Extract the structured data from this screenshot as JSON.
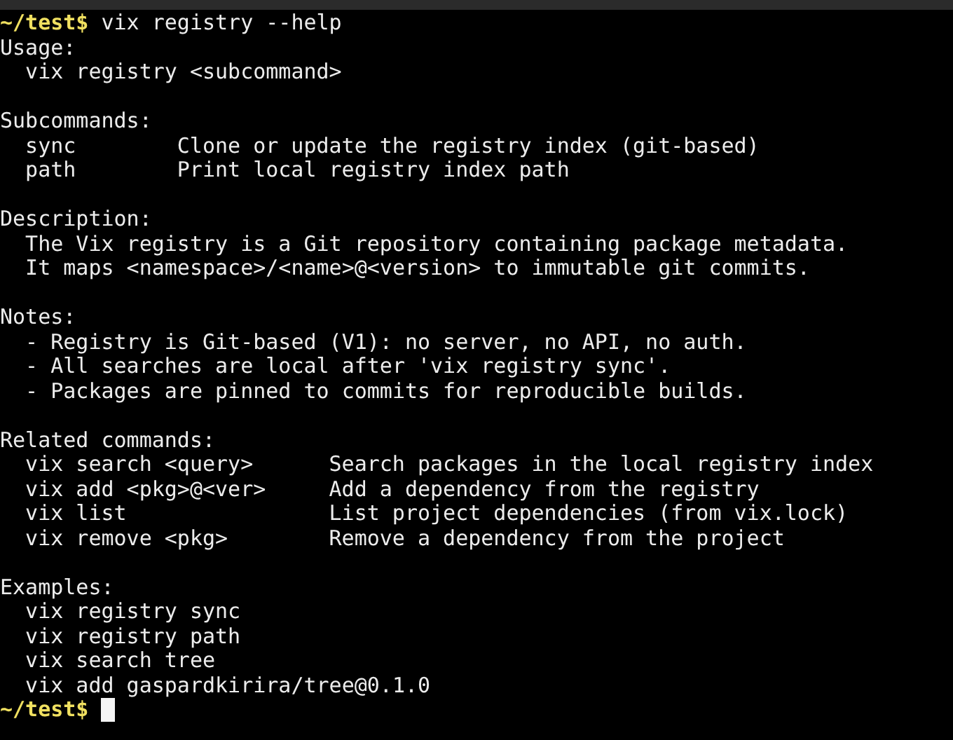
{
  "command_line": {
    "prompt": "~/test$",
    "command": "vix registry --help"
  },
  "sections": [
    {
      "heading": "Usage:",
      "lines": [
        {
          "kind": "text",
          "text": "vix registry <subcommand>"
        }
      ]
    },
    {
      "heading": "Subcommands:",
      "lines": [
        {
          "kind": "pair",
          "term": "sync",
          "description": "Clone or update the registry index (git-based)"
        },
        {
          "kind": "pair",
          "term": "path",
          "description": "Print local registry index path"
        }
      ]
    },
    {
      "heading": "Description:",
      "lines": [
        {
          "kind": "text",
          "text": "The Vix registry is a Git repository containing package metadata."
        },
        {
          "kind": "text",
          "text": "It maps <namespace>/<name>@<version> to immutable git commits."
        }
      ]
    },
    {
      "heading": "Notes:",
      "lines": [
        {
          "kind": "text",
          "text": "- Registry is Git-based (V1): no server, no API, no auth."
        },
        {
          "kind": "text",
          "text": "- All searches are local after 'vix registry sync'."
        },
        {
          "kind": "text",
          "text": "- Packages are pinned to commits for reproducible builds."
        }
      ]
    },
    {
      "heading": "Related commands:",
      "lines": [
        {
          "kind": "pair",
          "term": "vix search <query>",
          "description": "Search packages in the local registry index"
        },
        {
          "kind": "pair",
          "term": "vix add <pkg>@<ver>",
          "description": "Add a dependency from the registry"
        },
        {
          "kind": "pair",
          "term": "vix list",
          "description": "List project dependencies (from vix.lock)"
        },
        {
          "kind": "pair",
          "term": "vix remove <pkg>",
          "description": "Remove a dependency from the project"
        }
      ]
    },
    {
      "heading": "Examples:",
      "lines": [
        {
          "kind": "text",
          "text": "vix registry sync"
        },
        {
          "kind": "text",
          "text": "vix registry path"
        },
        {
          "kind": "text",
          "text": "vix search tree"
        },
        {
          "kind": "text",
          "text": "vix add gaspardkirira/tree@0.1.0"
        }
      ]
    }
  ],
  "input_line": {
    "prompt": "~/test$"
  }
}
